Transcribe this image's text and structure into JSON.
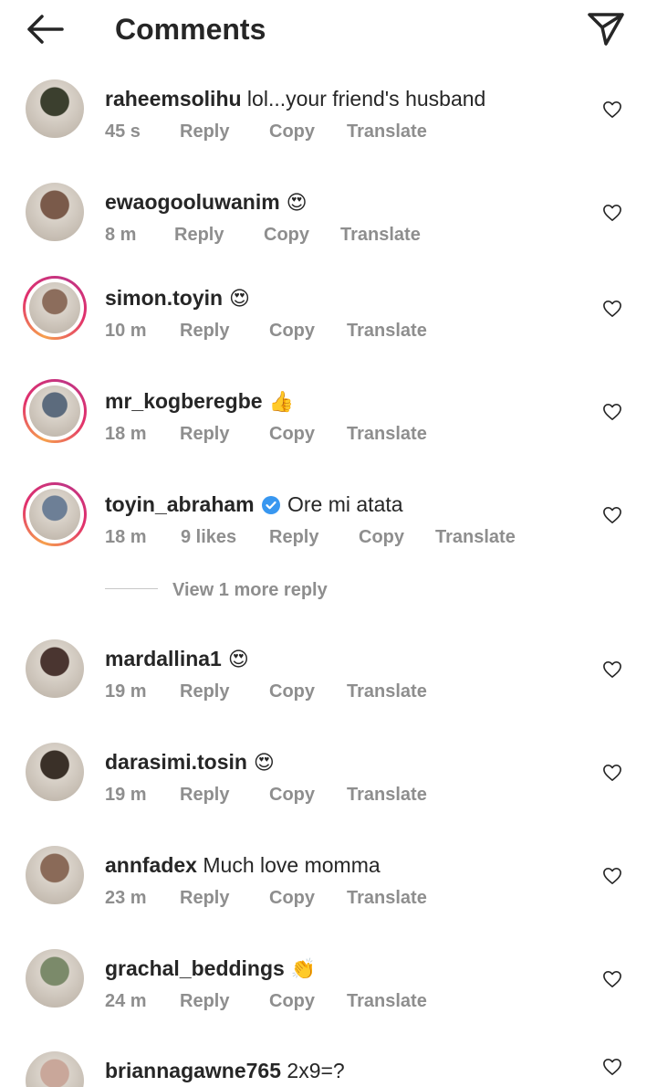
{
  "header": {
    "title": "Comments",
    "back_icon": "arrow-left-icon",
    "share_icon": "paper-plane-icon"
  },
  "actions": {
    "reply": "Reply",
    "copy": "Copy",
    "translate": "Translate"
  },
  "comments": [
    {
      "username": "raheemsolihu",
      "text": "lol...your friend's husband",
      "emoji": "",
      "time": "45 s",
      "likes": "",
      "verified": false,
      "story_ring": false,
      "avatar_color": "#3b3f2e"
    },
    {
      "username": "ewaogooluwanim",
      "text": "",
      "emoji": "😍",
      "time": "8 m",
      "likes": "",
      "verified": false,
      "story_ring": false,
      "avatar_color": "#7a5a4a"
    },
    {
      "username": "simon.toyin",
      "text": "",
      "emoji": "😍",
      "time": "10 m",
      "likes": "",
      "verified": false,
      "story_ring": true,
      "avatar_color": "#8c6d5c"
    },
    {
      "username": "mr_kogberegbe",
      "text": "",
      "emoji": "👍",
      "time": "18 m",
      "likes": "",
      "verified": false,
      "story_ring": true,
      "avatar_color": "#5c6b7d"
    },
    {
      "username": "toyin_abraham",
      "text": "Ore mi atata",
      "emoji": "",
      "time": "18 m",
      "likes": "9 likes",
      "verified": true,
      "story_ring": true,
      "avatar_color": "#6d7f96"
    },
    {
      "username": "mardallina1",
      "text": "",
      "emoji": "😍",
      "time": "19 m",
      "likes": "",
      "verified": false,
      "story_ring": false,
      "avatar_color": "#4a3530"
    },
    {
      "username": "darasimi.tosin",
      "text": "",
      "emoji": "😍",
      "time": "19 m",
      "likes": "",
      "verified": false,
      "story_ring": false,
      "avatar_color": "#3a3028"
    },
    {
      "username": "annfadex",
      "text": "Much love momma",
      "emoji": "",
      "time": "23 m",
      "likes": "",
      "verified": false,
      "story_ring": false,
      "avatar_color": "#8a6a58"
    },
    {
      "username": "grachal_beddings",
      "text": "",
      "emoji": "👏",
      "time": "24 m",
      "likes": "",
      "verified": false,
      "story_ring": false,
      "avatar_color": "#7b8a6a"
    },
    {
      "username": "briannagawne765",
      "text": "2x9=?",
      "emoji": "",
      "time": "",
      "likes": "",
      "verified": false,
      "story_ring": false,
      "avatar_color": "#c9a79a"
    }
  ],
  "view_more_replies": "View 1 more reply",
  "colors": {
    "text": "#262626",
    "meta": "#8e8e8e",
    "verified": "#3897f0"
  }
}
